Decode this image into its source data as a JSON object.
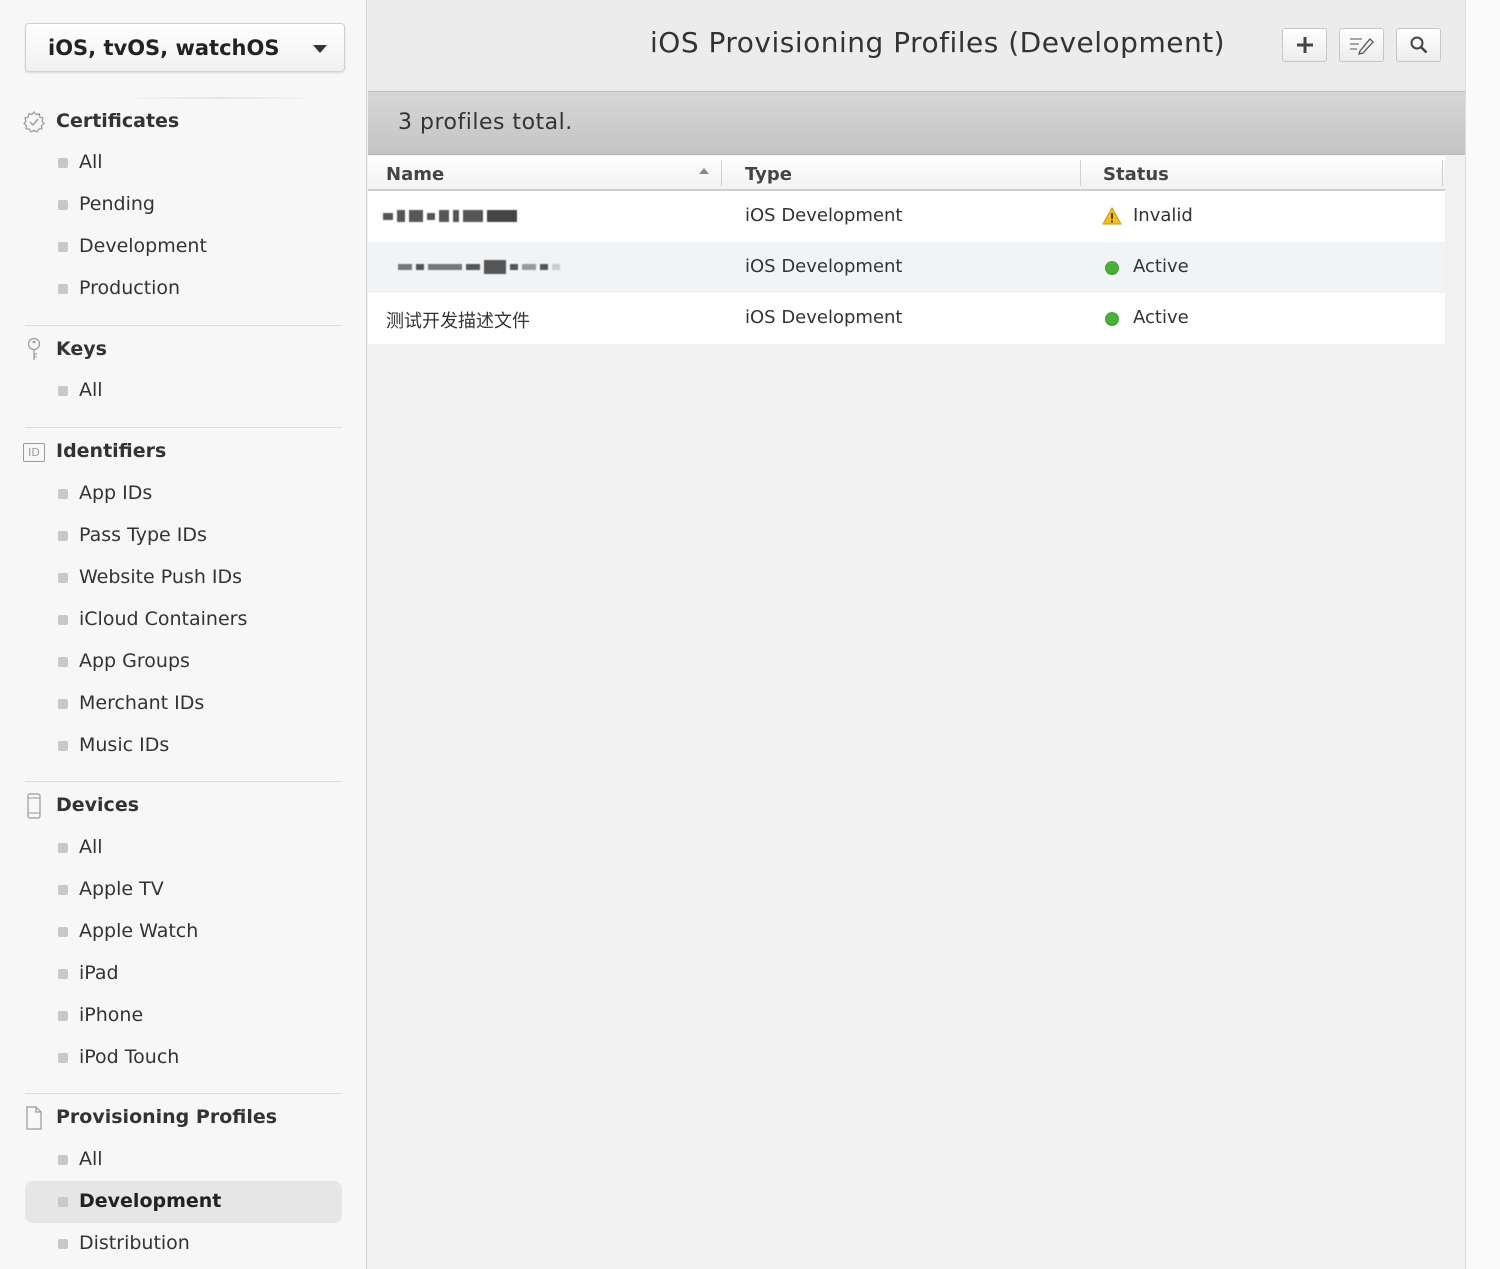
{
  "sidebar": {
    "platform": "iOS, tvOS, watchOS",
    "sections": {
      "certificates": {
        "title": "Certificates",
        "items": [
          "All",
          "Pending",
          "Development",
          "Production"
        ]
      },
      "keys": {
        "title": "Keys",
        "items": [
          "All"
        ]
      },
      "identifiers": {
        "title": "Identifiers",
        "icon_text": "ID",
        "items": [
          "App IDs",
          "Pass Type IDs",
          "Website Push IDs",
          "iCloud Containers",
          "App Groups",
          "Merchant IDs",
          "Music IDs"
        ]
      },
      "devices": {
        "title": "Devices",
        "items": [
          "All",
          "Apple TV",
          "Apple Watch",
          "iPad",
          "iPhone",
          "iPod Touch"
        ]
      },
      "profiles": {
        "title": "Provisioning Profiles",
        "items": [
          "All",
          "Development",
          "Distribution"
        ],
        "active_item": "Development"
      }
    }
  },
  "main": {
    "title": "iOS Provisioning Profiles (Development)",
    "summary": "3 profiles total.",
    "table": {
      "columns": [
        "Name",
        "Type",
        "Status"
      ],
      "rows": [
        {
          "name": "",
          "type": "iOS Development",
          "status": "Invalid"
        },
        {
          "name": "",
          "type": "iOS Development",
          "status": "Active"
        },
        {
          "name": "测试开发描述文件",
          "type": "iOS Development",
          "status": "Active"
        }
      ]
    }
  },
  "colors": {
    "active_status": "#4caf3a",
    "invalid_status": "#f0c020",
    "summary_bar": "#cccccc"
  }
}
